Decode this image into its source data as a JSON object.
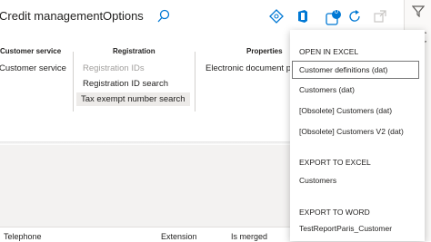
{
  "header": {
    "title": "Credit management",
    "options": "Options",
    "notification_count": "0"
  },
  "ribbon": {
    "groups": [
      {
        "header": "Customer service",
        "items": [
          "Customer service"
        ]
      },
      {
        "header": "Registration",
        "items": [
          "Registration IDs",
          "Registration ID search",
          "Tax exempt number search"
        ]
      },
      {
        "header": "Properties",
        "items": [
          "Electronic document pr"
        ]
      }
    ]
  },
  "grid": {
    "columns": [
      "Telephone",
      "Extension",
      "Is merged"
    ]
  },
  "menu": {
    "sections": [
      {
        "title": "OPEN IN EXCEL",
        "items": [
          "Customer definitions (dat)",
          "Customers (dat)",
          "[Obsolete] Customers (dat)",
          "[Obsolete] Customers V2 (dat)"
        ]
      },
      {
        "title": "EXPORT TO EXCEL",
        "items": [
          "Customers"
        ]
      },
      {
        "title": "EXPORT TO WORD",
        "items": [
          "TestReportParis_Customer"
        ]
      }
    ]
  },
  "colors": {
    "accent": "#0078d4",
    "highlight": "#ffff00"
  }
}
